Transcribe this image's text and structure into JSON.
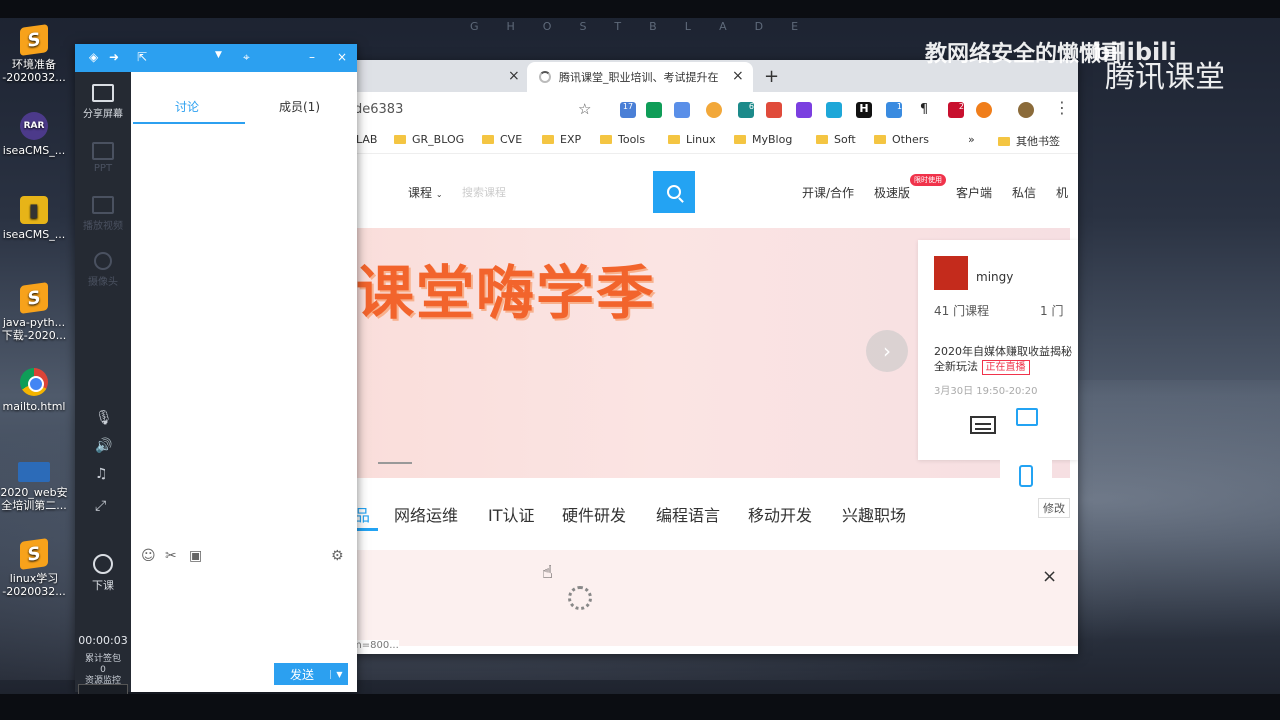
{
  "wordmark": "GHOSTBLADE",
  "watermark": {
    "title": "教网络安全的懒懒哥",
    "logo": "bilibili",
    "sub": "腾讯课堂"
  },
  "desktop": [
    {
      "label": "环境准备\n-2020032...",
      "icon": "sublime-icon"
    },
    {
      "label": "iseaCMS_...",
      "icon": "winrar-icon",
      "glyph": "RAR"
    },
    {
      "label": "iseaCMS_...",
      "icon": "book-icon"
    },
    {
      "label": "java-pyth...\n下载-2020...",
      "icon": "sublime-icon"
    },
    {
      "label": "mailto.html",
      "icon": "chrome-icon"
    },
    {
      "label": "2020_web安\n全培训第二...",
      "icon": "screen-icon"
    },
    {
      "label": "linux学习\n-2020032...",
      "icon": "sublime-icon"
    }
  ],
  "browser": {
    "tab_active": "腾讯课堂_职业培训、考试提升在",
    "url": "de6383",
    "bookmarks": [
      "LAB",
      "GR_BLOG",
      "CVE",
      "EXP",
      "Tools",
      "Linux",
      "MyBlog",
      "Soft",
      "Others"
    ],
    "bookmarks_more": "»",
    "other_bookmarks": "其他书签",
    "ext_labels": [
      "17",
      "6",
      "H",
      "1",
      "¶",
      "2"
    ],
    "nav": {
      "course_dropdown": "课程",
      "search_placeholder": "搜索课程",
      "links": [
        "开课/合作",
        "极速版",
        "客户端",
        "私信",
        "机"
      ],
      "badge": "限时使用"
    },
    "banner": {
      "text": "课堂嗨学季"
    },
    "card": {
      "username": "mingy",
      "courses": "41 门课程",
      "count2": "1 门",
      "notice": "2020年自媒体赚取收益揭秘全新玩法",
      "live": "正在直播",
      "time": "3月30日 19:50-20:20"
    },
    "categories": [
      "品",
      "网络运维",
      "IT认证",
      "硬件研发",
      "编程语言",
      "移动开发",
      "兴趣职场"
    ],
    "edit": "修改",
    "close": "×",
    "status": "m=800..."
  },
  "panel": {
    "rail": {
      "share": "分享屏幕",
      "ppt": "PPT",
      "video": "播放视频",
      "camera": "摄像头",
      "end": "下课",
      "timer": "00:00:03",
      "stat1": "累计签包",
      "stat1_value": "0",
      "stat2": "资源监控"
    },
    "tabs": {
      "discuss": "讨论",
      "members": "成员(1)"
    },
    "send": "发送"
  }
}
